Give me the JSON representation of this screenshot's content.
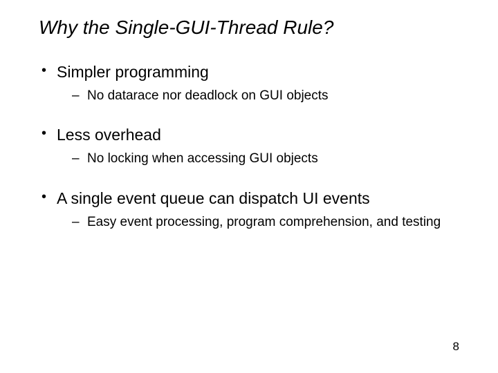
{
  "title": "Why the Single-GUI-Thread Rule?",
  "bullets": [
    {
      "text": "Simpler programming",
      "sub": [
        "No datarace nor deadlock on GUI objects"
      ]
    },
    {
      "text": "Less overhead",
      "sub": [
        "No locking when accessing GUI objects"
      ]
    },
    {
      "text": "A single event queue can dispatch UI events",
      "sub": [
        "Easy event processing, program comprehension, and testing"
      ]
    }
  ],
  "pageNumber": "8"
}
